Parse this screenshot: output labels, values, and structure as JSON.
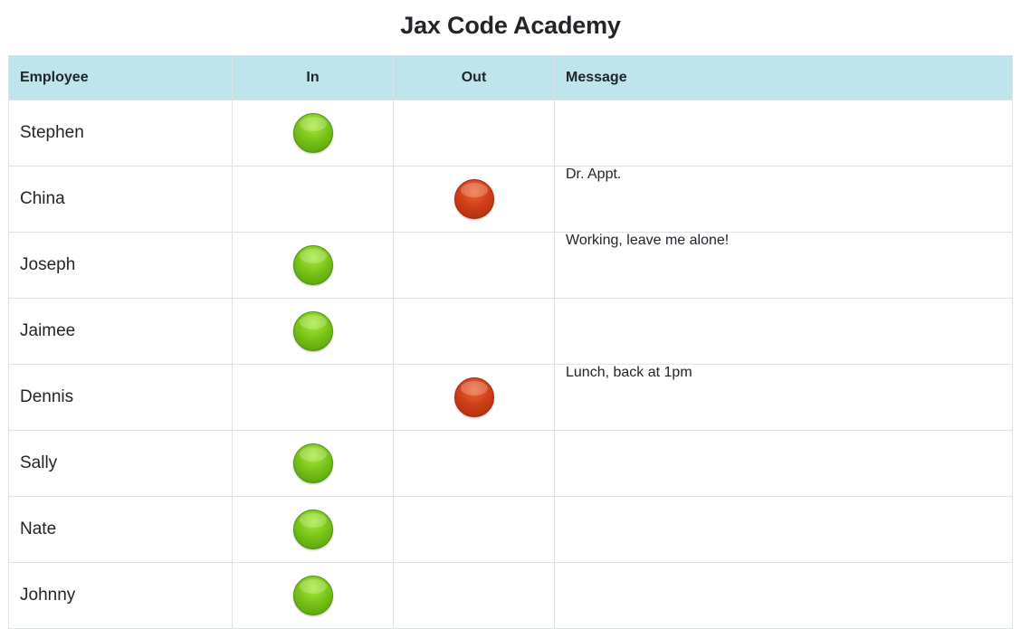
{
  "page": {
    "title": "Jax Code Academy"
  },
  "table": {
    "headers": {
      "employee": "Employee",
      "in": "In",
      "out": "Out",
      "message": "Message"
    },
    "rows": [
      {
        "name": "Stephen",
        "status": "in",
        "message": ""
      },
      {
        "name": "China",
        "status": "out",
        "message": "Dr. Appt."
      },
      {
        "name": "Joseph",
        "status": "in",
        "message": "Working, leave me alone!"
      },
      {
        "name": "Jaimee",
        "status": "in",
        "message": ""
      },
      {
        "name": "Dennis",
        "status": "out",
        "message": "Lunch, back at 1pm"
      },
      {
        "name": "Sally",
        "status": "in",
        "message": ""
      },
      {
        "name": "Nate",
        "status": "in",
        "message": ""
      },
      {
        "name": "Johnny",
        "status": "in",
        "message": ""
      }
    ]
  },
  "colors": {
    "header_background": "#bee5eb",
    "in_light": "#7cc51a",
    "out_light": "#d0401a",
    "border": "#dee2e6"
  },
  "icons": {
    "in": "green-status-light-icon",
    "out": "red-status-light-icon"
  }
}
